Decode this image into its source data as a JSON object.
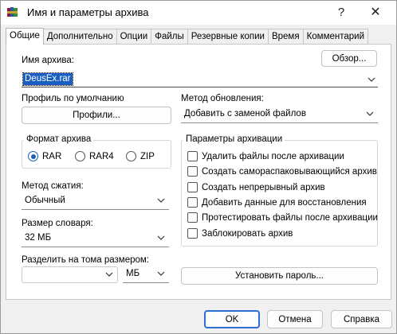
{
  "window": {
    "title": "Имя и параметры архива",
    "help_glyph": "?",
    "close_glyph": "✕"
  },
  "tabs": [
    {
      "label": "Общие",
      "active": true
    },
    {
      "label": "Дополнительно"
    },
    {
      "label": "Опции"
    },
    {
      "label": "Файлы"
    },
    {
      "label": "Резервные копии"
    },
    {
      "label": "Время"
    },
    {
      "label": "Комментарий"
    }
  ],
  "general": {
    "archive_name_label": "Имя архива:",
    "browse_button": "Обзор...",
    "archive_name_value": "DeusEx.rar",
    "default_profile_label": "Профиль по умолчанию",
    "profiles_button": "Профили...",
    "update_method_label": "Метод обновления:",
    "update_method_value": "Добавить с заменой файлов",
    "archive_format": {
      "title": "Формат архива",
      "options": [
        {
          "label": "RAR",
          "selected": true
        },
        {
          "label": "RAR4",
          "selected": false
        },
        {
          "label": "ZIP",
          "selected": false
        }
      ]
    },
    "compression_label": "Метод сжатия:",
    "compression_value": "Обычный",
    "dictionary_label": "Размер словаря:",
    "dictionary_value": "32 МБ",
    "split_label": "Разделить на тома размером:",
    "split_value": "",
    "split_unit": "МБ",
    "set_password_button": "Установить пароль...",
    "archive_options": {
      "title": "Параметры архивации",
      "items": [
        {
          "label": "Удалить файлы после архивации",
          "checked": false
        },
        {
          "label": "Создать самораспаковывающийся архив",
          "checked": false
        },
        {
          "label": "Создать непрерывный архив",
          "checked": false
        },
        {
          "label": "Добавить данные для восстановления",
          "checked": false
        },
        {
          "label": "Протестировать файлы после архивации",
          "checked": false
        },
        {
          "label": "Заблокировать архив",
          "checked": false
        }
      ]
    }
  },
  "footer": {
    "ok": "OK",
    "cancel": "Отмена",
    "help": "Справка"
  },
  "colors": {
    "accent": "#1a5fc4",
    "window_bg": "#f0f0f0",
    "panel_bg": "#ffffff"
  },
  "icons": {
    "app": "winrar-books-icon",
    "dropdown": "chevron-down-icon"
  }
}
